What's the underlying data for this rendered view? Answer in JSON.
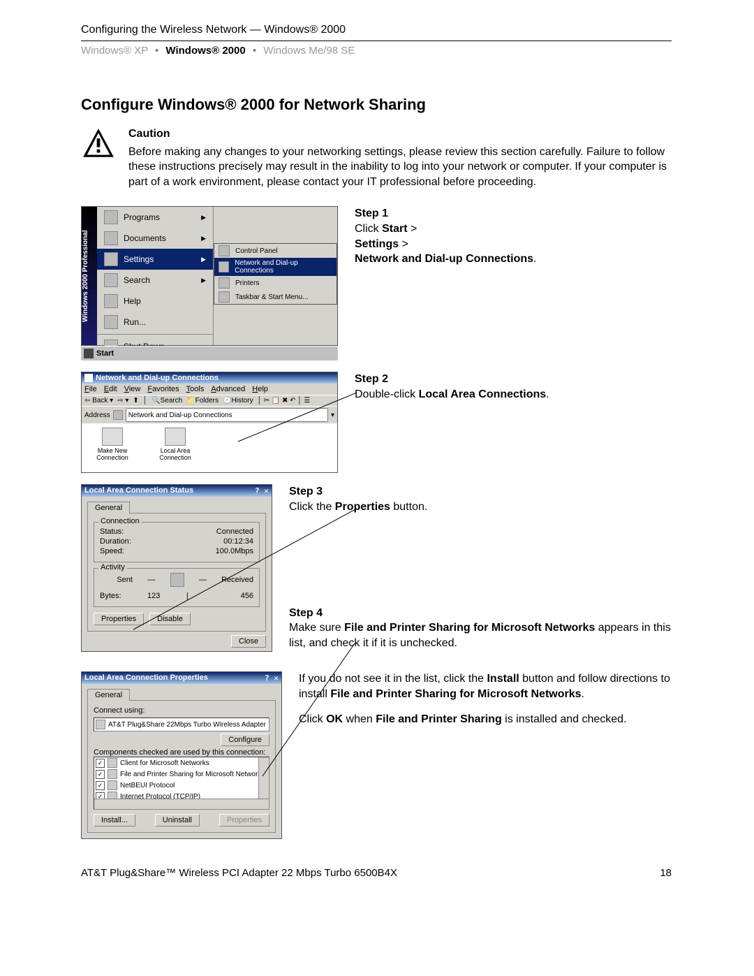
{
  "header": {
    "path": "Configuring the Wireless Network — Windows® 2000",
    "crumbs": [
      "Windows® XP",
      "Windows® 2000",
      "Windows Me/98 SE"
    ],
    "active_crumb": 1
  },
  "title": "Configure Windows® 2000 for Network Sharing",
  "caution": {
    "heading": "Caution",
    "body": "Before making any changes to your networking settings, please review this section carefully. Failure to follow these instructions precisely may result in the inability to log into your network or computer. If your computer is part of a work environment, please contact your IT professional before proceeding."
  },
  "startmenu": {
    "banner": "Windows 2000 Professional",
    "items": [
      "Programs",
      "Documents",
      "Settings",
      "Search",
      "Help",
      "Run...",
      "Shut Down..."
    ],
    "submenu": [
      "Control Panel",
      "Network and Dial-up Connections",
      "Printers",
      "Taskbar & Start Menu..."
    ],
    "highlighted": "Settings",
    "sub_highlight": "Network and Dial-up Connections",
    "start_button": "Start"
  },
  "explorer": {
    "title": "Network and Dial-up Connections",
    "menus": [
      "File",
      "Edit",
      "View",
      "Favorites",
      "Tools",
      "Advanced",
      "Help"
    ],
    "tb_back": "Back",
    "tb_search": "Search",
    "tb_folders": "Folders",
    "tb_history": "History",
    "addr_label": "Address",
    "addr_value": "Network and Dial-up Connections",
    "icons": [
      "Make New Connection",
      "Local Area Connection"
    ]
  },
  "status": {
    "title": "Local Area Connection Status",
    "tab": "General",
    "grp1": "Connection",
    "k_status": "Status:",
    "v_status": "Connected",
    "k_duration": "Duration:",
    "v_duration": "00:12:34",
    "k_speed": "Speed:",
    "v_speed": "100.0Mbps",
    "grp2": "Activity",
    "sent": "Sent",
    "recv": "Received",
    "k_bytes": "Bytes:",
    "v_sent": "123",
    "v_recv": "456",
    "btn_props": "Properties",
    "btn_disable": "Disable",
    "btn_close": "Close"
  },
  "props": {
    "title": "Local Area Connection Properties",
    "tab": "General",
    "connect_using": "Connect using:",
    "adapter": "AT&T Plug&Share 22Mbps Turbo Wireless Adapter",
    "btn_configure": "Configure",
    "components_label": "Components checked are used by this connection:",
    "components": [
      "Client for Microsoft Networks",
      "File and Printer Sharing for Microsoft Networks",
      "NetBEUI Protocol",
      "Internet Protocol (TCP/IP)"
    ],
    "btn_install": "Install...",
    "btn_uninstall": "Uninstall",
    "btn_properties": "Properties"
  },
  "steps": {
    "s1h": "Step 1",
    "s1a": "Click ",
    "s1a_b": "Start",
    "s1a2": " > ",
    "s1b_b": "Settings",
    "s1b2": " > ",
    "s1c_b": "Network and Dial-up Connections",
    "s1e": ".",
    "s2h": "Step 2",
    "s2a": "Double-click ",
    "s2a_b": "Local Area Connections",
    "s2e": ".",
    "s3h": "Step 3",
    "s3a": "Click the ",
    "s3a_b": "Properties",
    "s3a2": " button.",
    "s4h": "Step 4",
    "s4a1": "Make sure ",
    "s4a_b": "File and Printer Sharing for Microsoft Networks",
    "s4a2": " appears in this list, and check it if it is unchecked.",
    "s4b1": "If you do not see it in the list, click the ",
    "s4b_b1": "Install",
    "s4b2": " button and follow directions to install ",
    "s4b_b2": "File and Printer Sharing for Microsoft Networks",
    "s4b3": ".",
    "s4c1": "Click ",
    "s4c_b1": "OK",
    "s4c2": " when ",
    "s4c_b2": "File and Printer Sharing",
    "s4c3": " is installed and checked."
  },
  "footer": {
    "left": "AT&T Plug&Share™ Wireless PCI Adapter 22 Mbps Turbo 6500B4X",
    "right": "18"
  }
}
